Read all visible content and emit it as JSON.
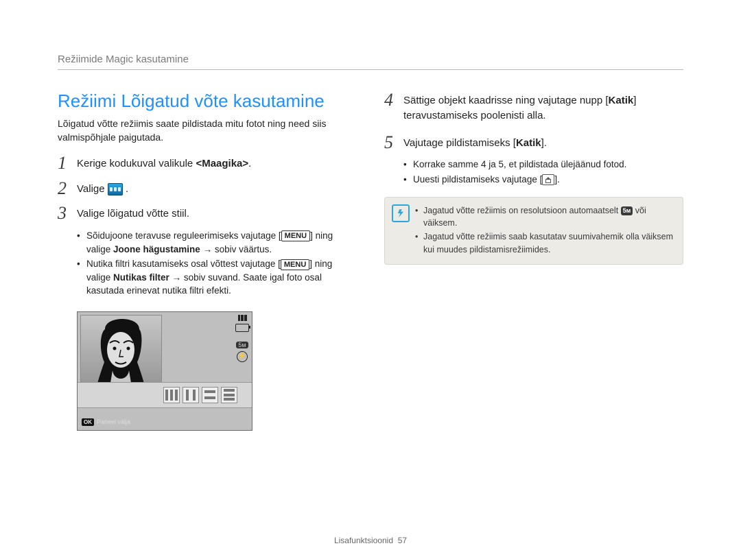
{
  "breadcrumb": "Režiimide Magic kasutamine",
  "left": {
    "title": "Režiimi Lõigatud võte kasutamine",
    "intro": "Lõigatud võtte režiimis saate pildistada mitu fotot ning need siis valmispõhjale paigutada.",
    "step1": {
      "num": "1",
      "text_a": "Kerige kodukuval valikule ",
      "text_b": "<Maagika>",
      "text_c": "."
    },
    "step2": {
      "num": "2",
      "text_a": "Valige ",
      "text_c": "."
    },
    "step3": {
      "num": "3",
      "text": "Valige lõigatud võtte stiil.",
      "bullets": [
        {
          "a": "Sõidujoone teravuse reguleerimiseks vajutage [",
          "menu": "MENU",
          "b": "] ning valige ",
          "bold": "Joone hägustamine",
          "c": " → sobiv väärtus."
        },
        {
          "a": "Nutika filtri kasutamiseks osal võttest vajutage [",
          "menu": "MENU",
          "b": "] ning valige ",
          "bold": "Nutikas filter",
          "c": " → sobiv suvand. Saate igal foto osal kasutada erinevat nutika filtri efekti."
        }
      ]
    },
    "camera": {
      "ok_label": "Paneel välja",
      "res_label": "5м"
    }
  },
  "right": {
    "step4": {
      "num": "4",
      "text_a": "Sättige objekt kaadrisse ning vajutage nupp [",
      "bold": "Katik",
      "text_b": "] teravustamiseks poolenisti alla."
    },
    "step5": {
      "num": "5",
      "text_a": "Vajutage pildistamiseks [",
      "bold": "Katik",
      "text_b": "].",
      "bullets": [
        "Korrake samme 4 ja 5, et pildistada ülejäänud fotod.",
        "Uuesti pildistamiseks vajutage ["
      ],
      "bullet2_tail": "]."
    },
    "notes": [
      {
        "a": "Jagatud võtte režiimis on resolutsioon automaatselt ",
        "chip": "5м",
        "b": " või väiksem."
      },
      {
        "a": "Jagatud võtte režiimis saab kasutatav suumivahemik olla väiksem kui muudes pildistamisrežiimides."
      }
    ]
  },
  "footer": {
    "section": "Lisafunktsioonid",
    "page": "57"
  }
}
